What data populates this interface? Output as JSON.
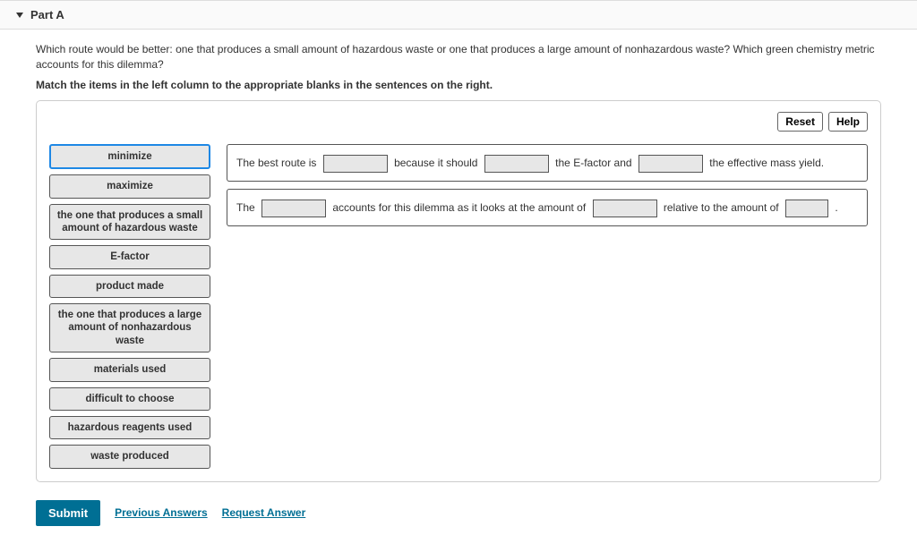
{
  "header": {
    "part_label": "Part A"
  },
  "question_text": "Which route would be better: one that produces a small amount of hazardous waste or one that produces a large amount of nonhazardous waste? Which green chemistry metric accounts for this dilemma?",
  "instructions": "Match the items in the left column to the appropriate blanks in the sentences on the right.",
  "panel": {
    "reset_label": "Reset",
    "help_label": "Help"
  },
  "tokens": [
    "minimize",
    "maximize",
    "the one that produces a small amount of hazardous waste",
    "E-factor",
    "product made",
    "the one that produces a large amount of nonhazardous waste",
    "materials used",
    "difficult to choose",
    "hazardous reagents used",
    "waste produced"
  ],
  "sentence1": {
    "seg1": "The best route is",
    "seg2": "because it should",
    "seg3": "the E-factor and",
    "seg4": "the effective mass yield."
  },
  "sentence2": {
    "seg1": "The",
    "seg2": "accounts for this dilemma as it looks at the amount of",
    "seg3": "relative to the amount of",
    "seg4": "."
  },
  "footer": {
    "submit": "Submit",
    "previous": "Previous Answers",
    "request": "Request Answer"
  }
}
